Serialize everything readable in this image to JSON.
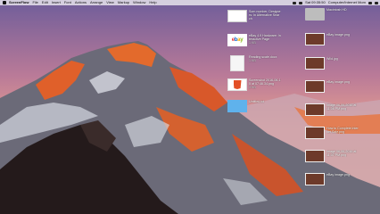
{
  "menubar": {
    "app_name": "ScreenFlow",
    "menus": [
      "File",
      "Edit",
      "Insert",
      "Font",
      "Actions",
      "Arrange",
      "View",
      "Markup",
      "Window",
      "Help"
    ],
    "clock": "Sat 09:35:50",
    "user": "Computer/Internet Mom"
  },
  "desktop": {
    "icons": [
      {
        "id": "a",
        "label": "Som number, Designers: In Alternative Search",
        "size": "",
        "thumb": "blank-doc-icon"
      },
      {
        "id": "b",
        "label": "eBay 4.9 Hardware: Interactive Page",
        "size": "1 KB",
        "thumb": "ebay-icon"
      },
      {
        "id": "c",
        "label": "Reading scale.docx",
        "size": "1 KB",
        "thumb": "document-icon"
      },
      {
        "id": "d",
        "label": "Screenshot 2016-06-15 at 07.46.34.png",
        "size": "3 KB",
        "thumb": "html5-icon"
      },
      {
        "id": "e",
        "label": "Untitled.txt",
        "size": "",
        "thumb": "blue-doc-icon"
      },
      {
        "id": "f",
        "label": "Macintosh HD",
        "size": "",
        "thumb": "hard-drive-icon"
      },
      {
        "id": "g",
        "label": "eBay image.png",
        "size": "",
        "thumb": "screenshot-icon"
      },
      {
        "id": "h",
        "label": "Wild.jpg",
        "size": "",
        "thumb": "screenshot-icon"
      },
      {
        "id": "i",
        "label": "eBay image.png",
        "size": "",
        "thumb": "screenshot-icon"
      },
      {
        "id": "j",
        "label": "Image 06-06-2016 at 11.08 PM.png",
        "size": "",
        "thumb": "screenshot-icon"
      },
      {
        "id": "k",
        "label": "How to Complete Internet Sale.png",
        "size": "",
        "thumb": "screenshot-icon"
      },
      {
        "id": "l",
        "label": "Image 06-06-2016 at 11.07 PM.png",
        "size": "",
        "thumb": "screenshot-icon"
      },
      {
        "id": "m",
        "label": "eBay image.png",
        "size": "",
        "thumb": "screenshot-icon"
      }
    ]
  }
}
